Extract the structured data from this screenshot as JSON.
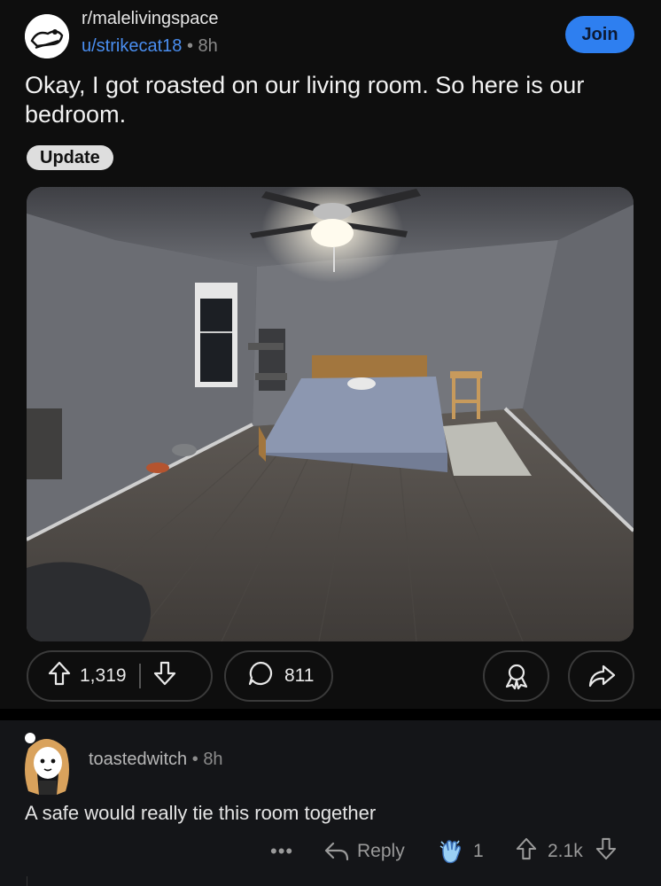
{
  "post": {
    "subreddit": "r/malelivingspace",
    "author": "u/strikecat18",
    "separator": "•",
    "age": "8h",
    "join_label": "Join",
    "title": "Okay, I got roasted on our living room. So here is our bedroom.",
    "flair": "Update",
    "upvotes": "1,319",
    "comments": "811"
  },
  "comment": {
    "author": "toastedwitch",
    "separator": "•",
    "age": "8h",
    "body": "A safe would really tie this room together",
    "more": "•••",
    "reply_label": "Reply",
    "award_count": "1",
    "score": "2.1k"
  },
  "icons": {
    "upvote": "arrow-up-outline-icon",
    "downvote": "arrow-down-outline-icon",
    "comment": "speech-bubble-icon",
    "award": "award-ribbon-icon",
    "share": "share-arrow-icon",
    "reply": "reply-arrow-icon",
    "clap_award": "clapping-hands-icon"
  },
  "colors": {
    "background": "#0e0e0e",
    "accent": "#2e7ff0",
    "username": "#4a8ef0",
    "comment_bg": "#141518"
  }
}
